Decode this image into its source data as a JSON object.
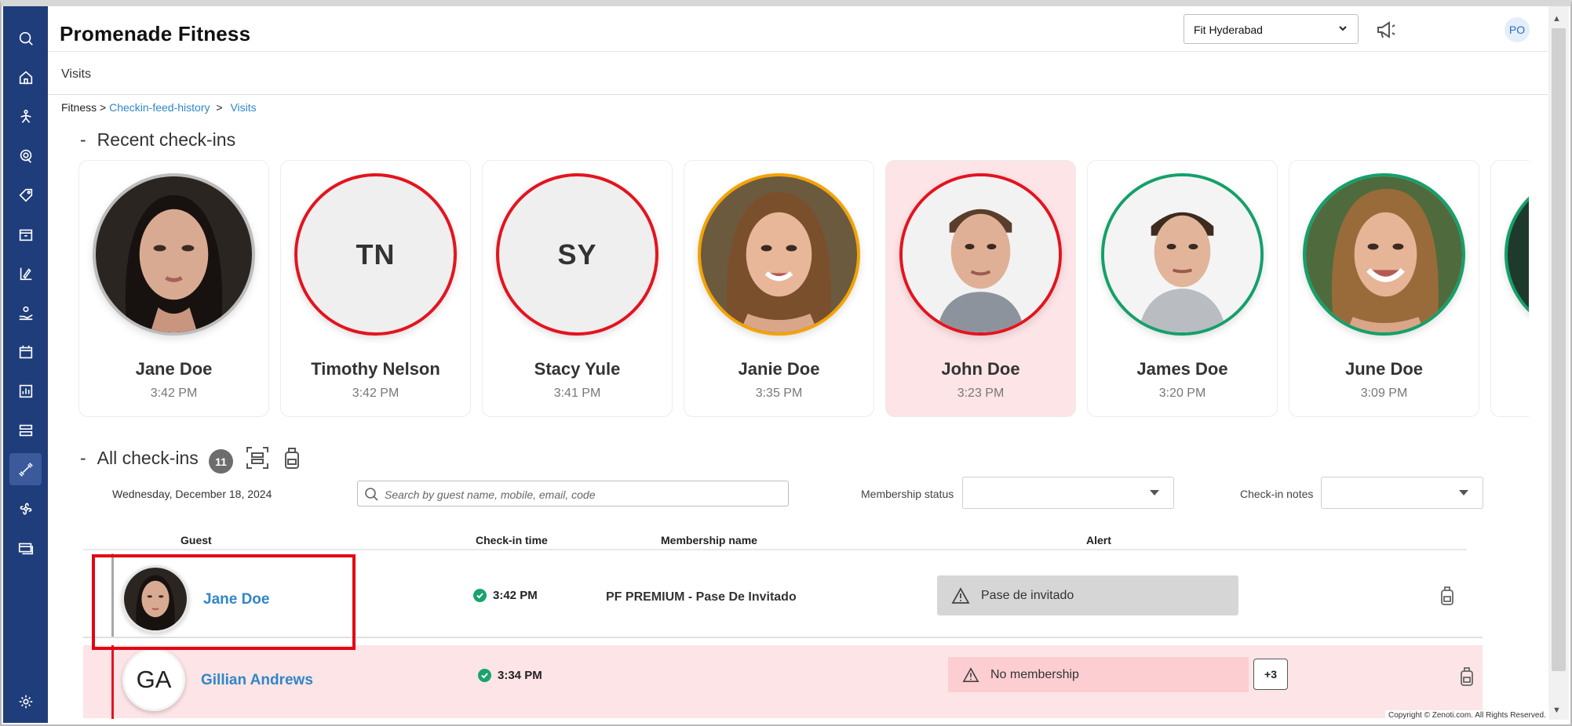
{
  "app": {
    "title": "Promenade Fitness"
  },
  "header": {
    "location": "Fit Hyderabad",
    "user_initials": "PO"
  },
  "subnav": {
    "page": "Visits"
  },
  "breadcrumb": {
    "root": "Fitness >",
    "link1": "Checkin-feed-history",
    "sep": ">",
    "link2": "Visits"
  },
  "recent": {
    "dash": "-",
    "title": "Recent check-ins",
    "cards": [
      {
        "name": "Jane Doe",
        "time": "3:42 PM",
        "initials": "",
        "ring": "grey"
      },
      {
        "name": "Timothy Nelson",
        "time": "3:42 PM",
        "initials": "TN",
        "ring": "red"
      },
      {
        "name": "Stacy Yule",
        "time": "3:41 PM",
        "initials": "SY",
        "ring": "red"
      },
      {
        "name": "Janie Doe",
        "time": "3:35 PM",
        "initials": "",
        "ring": "orange"
      },
      {
        "name": "John Doe",
        "time": "3:23 PM",
        "initials": "",
        "ring": "red"
      },
      {
        "name": "James Doe",
        "time": "3:20 PM",
        "initials": "",
        "ring": "green"
      },
      {
        "name": "June Doe",
        "time": "3:09 PM",
        "initials": "",
        "ring": "green"
      }
    ]
  },
  "all": {
    "dash": "-",
    "title": "All check-ins",
    "count": "11",
    "date": "Wednesday, December 18, 2024",
    "search_placeholder": "Search by guest name, mobile, email, code",
    "membership_status_label": "Membership status",
    "checkin_notes_label": "Check-in notes",
    "columns": {
      "guest": "Guest",
      "time": "Check-in time",
      "membership": "Membership name",
      "alert": "Alert"
    },
    "rows": [
      {
        "guest": "Jane Doe",
        "time": "3:42 PM",
        "membership": "PF PREMIUM - Pase De Invitado",
        "alert": "Pase de invitado"
      },
      {
        "guest": "Gillian Andrews",
        "initials": "GA",
        "time": "3:34 PM",
        "membership": "",
        "alert": "No membership",
        "more": "+3"
      }
    ]
  },
  "footer": {
    "copyright": "Copyright © Zenoti.com. All Rights Reserved."
  },
  "colors": {
    "sidebar": "#1f3d7a",
    "link": "#2f86c9",
    "alert_red": "#e3141f",
    "success": "#1aa36e"
  }
}
